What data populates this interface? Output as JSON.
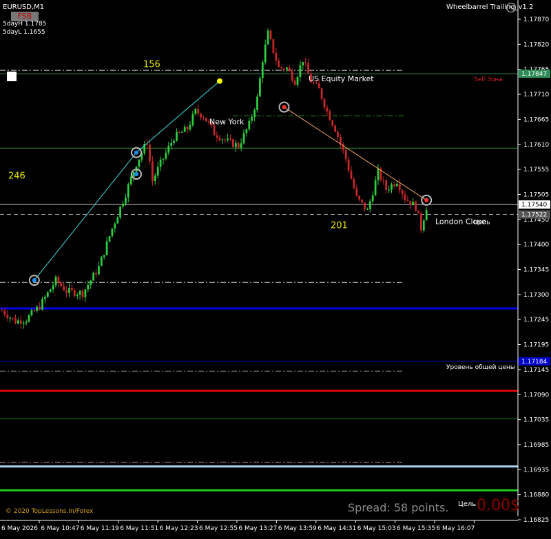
{
  "header": {
    "symbol": "EURUSD,M1",
    "badge": "FSB",
    "day_high": "5dayH 1.1785",
    "day_low": "5dayL 1.1655",
    "indicator_title": "Wheelbarrel Trailing_v1.2",
    "close_icon": "x-icon"
  },
  "footer": {
    "copyright": "© 2020 TopLessons.In/Forex",
    "spread": "Spread: 58 points.",
    "target_label": "Цель",
    "money": "0.00$"
  },
  "chart_data": {
    "type": "candlestick",
    "symbol": "EURUSD",
    "timeframe": "M1",
    "ylim": [
      1.16825,
      1.17995
    ],
    "price_ticks": [
      "1.17870",
      "1.17820",
      "1.17765",
      "1.17710",
      "1.17665",
      "1.17610",
      "1.17555",
      "1.17505",
      "1.17450",
      "1.17400",
      "1.17345",
      "1.17300",
      "1.17245",
      "1.17195",
      "1.17145",
      "1.17090",
      "1.17035",
      "1.16985",
      "1.16935",
      "1.16880",
      "1.16825"
    ],
    "time_labels": [
      "6 May 2026",
      "6 May 10:47",
      "6 May 11:19",
      "6 May 11:51",
      "6 May 12:23",
      "6 May 12:55",
      "6 May 13:27",
      "6 May 13:59",
      "6 May 14:31",
      "6 May 15:03",
      "6 May 15:35",
      "6 May 16:07"
    ],
    "top_price": "1.17870",
    "bottom_price": "1.16825",
    "price_path": [
      [
        0,
        1.173
      ],
      [
        5,
        1.17275
      ],
      [
        9,
        1.1728
      ],
      [
        14,
        1.1731
      ],
      [
        20,
        1.1737
      ],
      [
        24,
        1.17345
      ],
      [
        30,
        1.1734
      ],
      [
        36,
        1.174
      ],
      [
        41,
        1.1749
      ],
      [
        46,
        1.1757
      ],
      [
        50,
        1.1764
      ],
      [
        54,
        1.1769
      ],
      [
        56,
        1.176
      ],
      [
        59,
        1.1764
      ],
      [
        64,
        1.177
      ],
      [
        69,
        1.1772
      ],
      [
        72,
        1.1776
      ],
      [
        75,
        1.1775
      ],
      [
        79,
        1.1771
      ],
      [
        84,
        1.1769
      ],
      [
        88,
        1.1768
      ],
      [
        92,
        1.1773
      ],
      [
        95,
        1.1779
      ],
      [
        97,
        1.1788
      ],
      [
        99,
        1.1794
      ],
      [
        101,
        1.179
      ],
      [
        103,
        1.1786
      ],
      [
        106,
        1.1786
      ],
      [
        109,
        1.1783
      ],
      [
        112,
        1.1788
      ],
      [
        115,
        1.1783
      ],
      [
        118,
        1.1781
      ],
      [
        121,
        1.1776
      ],
      [
        124,
        1.1772
      ],
      [
        128,
        1.1765
      ],
      [
        132,
        1.1756
      ],
      [
        136,
        1.1753
      ],
      [
        140,
        1.1762
      ],
      [
        143,
        1.1758
      ],
      [
        147,
        1.176
      ],
      [
        150,
        1.1756
      ],
      [
        154,
        1.1754
      ],
      [
        156,
        1.1749
      ],
      [
        158,
        1.1754
      ]
    ],
    "levels": [
      {
        "name": "sell-zone-line",
        "price": 1.17847,
        "color": "#2e8b57",
        "style": "solid",
        "tag": "1.17847",
        "tag_bg": "#2e8b57"
      },
      {
        "name": "upper-dashdot",
        "price": 1.17855,
        "color": "#d3d3d3",
        "style": "dashdot",
        "end": 0.78
      },
      {
        "name": "green-dashdot-1",
        "price": 1.1775,
        "color": "#228b22",
        "style": "dashdot",
        "start": 0.45,
        "end": 0.78
      },
      {
        "name": "green-solid-1",
        "price": 1.17675,
        "color": "#2e8b2e",
        "style": "solid"
      },
      {
        "name": "white-solid",
        "price": 1.17545,
        "color": "#c8c8c8",
        "style": "solid",
        "tag": "1.17540",
        "tag_bg": "#ffffff"
      },
      {
        "name": "white-dashed",
        "price": 1.17522,
        "color": "#a0a0a0",
        "style": "dashed",
        "tag": "1.17522",
        "tag_bg": "#555555"
      },
      {
        "name": "white-dashdot-2",
        "price": 1.17365,
        "color": "#d3d3d3",
        "style": "dashdot",
        "end": 0.78
      },
      {
        "name": "blue-thick",
        "price": 1.17305,
        "color": "#0000e6",
        "style": "thick"
      },
      {
        "name": "blue-thin",
        "price": 1.17183,
        "color": "#0000cd",
        "style": "solid",
        "tag": "1.17184",
        "tag_bg": "#0000cd"
      },
      {
        "name": "gray-dashdot",
        "price": 1.1716,
        "color": "#888888",
        "style": "dashdot",
        "end": 0.78
      },
      {
        "name": "red-thick",
        "price": 1.17115,
        "color": "#e00000",
        "style": "thick"
      },
      {
        "name": "green-solid-2",
        "price": 1.1705,
        "color": "#1e7a1e",
        "style": "solid"
      },
      {
        "name": "pink-dashdot",
        "price": 1.1695,
        "color": "#b08080",
        "style": "dashdot",
        "end": 0.78
      },
      {
        "name": "lightblue-thick",
        "price": 1.1694,
        "color": "#a8d8f0",
        "style": "thick"
      },
      {
        "name": "lime-thick",
        "price": 1.16885,
        "color": "#22cc22",
        "style": "thick"
      }
    ],
    "annotations": [
      {
        "name": "count-156",
        "text": "156",
        "color": "#e6e600",
        "size": 13,
        "cx": 0.26,
        "price": 1.17862
      },
      {
        "name": "count-246",
        "text": "246",
        "color": "#e6e600",
        "size": 13,
        "cx": 0.015,
        "price": 1.17605
      },
      {
        "name": "count-201",
        "text": "201",
        "color": "#e6e600",
        "size": 13,
        "cx": 0.6,
        "price": 1.1749
      },
      {
        "name": "label-new-york",
        "text": "New York",
        "color": "#ffffff",
        "size": 11,
        "cx": 0.38,
        "price": 1.1773
      },
      {
        "name": "label-us-equity",
        "text": "US Equity Market",
        "color": "#ffffff",
        "size": 11,
        "cx": 0.56,
        "price": 1.1783
      },
      {
        "name": "label-london-close",
        "text": "London Close",
        "color": "#ffffff",
        "size": 11,
        "cx": 0.79,
        "price": 1.175
      },
      {
        "name": "label-sell-zone",
        "text": "Sell Зона",
        "color": "#cc2222",
        "size": 9,
        "cx": 0.86,
        "price": 1.1783
      },
      {
        "name": "label-target",
        "text": "Цель",
        "color": "#ffffff",
        "size": 9,
        "cx": 0.86,
        "price": 1.175
      },
      {
        "name": "label-general-level",
        "text": "Уровень общей цены",
        "color": "#ffffff",
        "size": 9,
        "cx": 0.81,
        "price": 1.17165
      }
    ],
    "cyan_zigzag": [
      [
        12,
        1.1737
      ],
      [
        50,
        1.17665
      ],
      [
        64,
        1.1774
      ],
      [
        81,
        1.1783
      ]
    ],
    "orange_trend": [
      [
        105,
        1.1777
      ],
      [
        158,
        1.17555
      ]
    ],
    "markers": [
      {
        "name": "marker-entry-1",
        "bar": 12,
        "price": 1.1737,
        "color": "#1e90ff"
      },
      {
        "name": "marker-entry-2",
        "bar": 50,
        "price": 1.17665,
        "color": "#1e90ff"
      },
      {
        "name": "marker-entry-3",
        "bar": 50,
        "price": 1.17615,
        "color": "#1e90ff"
      },
      {
        "name": "marker-exit-1",
        "bar": 105,
        "price": 1.1777,
        "color": "#ff3030"
      },
      {
        "name": "marker-exit-2",
        "bar": 158,
        "price": 1.17555,
        "color": "#ff3030"
      }
    ],
    "colors": {
      "bull": "#2ecc40",
      "bear": "#c62828",
      "background": "#000000",
      "axis_text": "#ffffff"
    }
  }
}
